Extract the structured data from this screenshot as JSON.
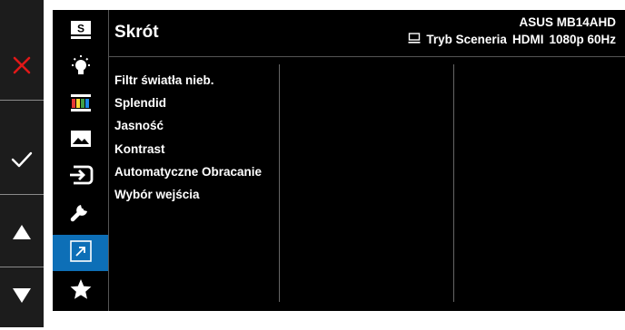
{
  "colors": {
    "accent": "#0d6fb7",
    "close": "#e01818",
    "osd_bg": "#000000"
  },
  "keys": [
    {
      "icon": "close-icon"
    },
    {
      "icon": "check-icon"
    },
    {
      "icon": "arrow-up-icon"
    },
    {
      "icon": "arrow-down-icon"
    }
  ],
  "sidebar": {
    "items": [
      {
        "icon": "s-mode-icon",
        "label": "S"
      },
      {
        "icon": "blue-light-filter-icon"
      },
      {
        "icon": "splendid-color-icon"
      },
      {
        "icon": "image-icon"
      },
      {
        "icon": "input-select-icon"
      },
      {
        "icon": "system-setup-icon"
      },
      {
        "icon": "shortcut-icon",
        "active": true
      },
      {
        "icon": "favorite-star-icon"
      }
    ]
  },
  "header": {
    "title": "Skrót",
    "model": "ASUS MB14AHD",
    "mode": "Tryb Sceneria",
    "input": "HDMI",
    "resolution": "1080p 60Hz"
  },
  "menu": {
    "items": [
      "Filtr światła nieb.",
      "Splendid",
      "Jasność",
      "Kontrast",
      "Automatyczne Obracanie",
      "Wybór wejścia"
    ]
  }
}
